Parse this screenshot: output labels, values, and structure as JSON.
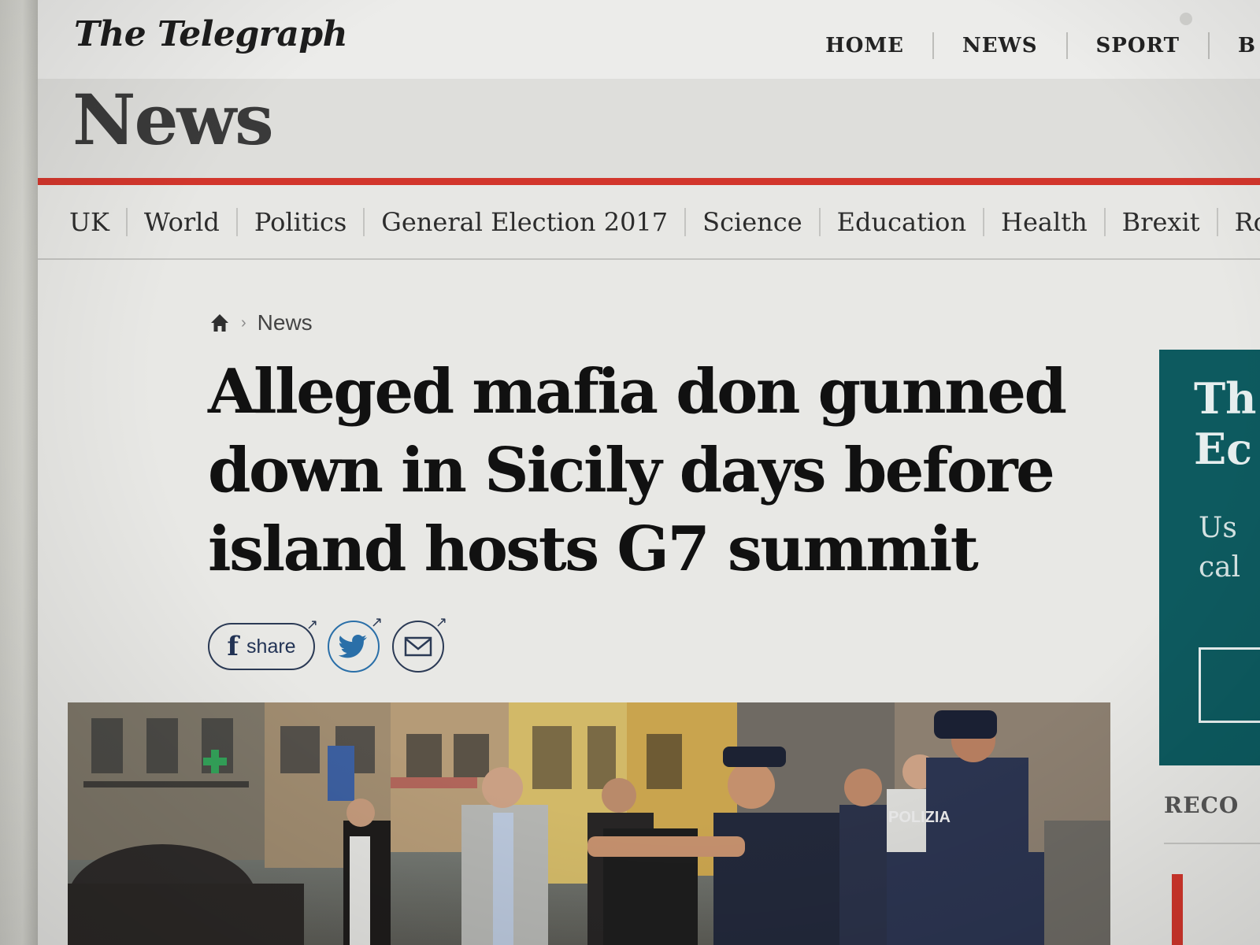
{
  "masthead": {
    "logo": "The Telegraph",
    "nav": [
      "HOME",
      "NEWS",
      "SPORT",
      "B"
    ]
  },
  "section": {
    "title": "News"
  },
  "subnav": {
    "items": [
      "UK",
      "World",
      "Politics",
      "General Election 2017",
      "Science",
      "Education",
      "Health",
      "Brexit",
      "Roy"
    ]
  },
  "breadcrumb": {
    "current": "News",
    "separator": "›"
  },
  "article": {
    "headline": "Alleged mafia don gunned down in Sicily days before island hosts G7 summit"
  },
  "share": {
    "facebook_glyph": "f",
    "facebook_label": "share",
    "external_arrow": "↗"
  },
  "photo": {
    "sign_text": "POLIZIA"
  },
  "promo": {
    "title_line1": "Th",
    "title_line2": "Ec",
    "text_line1": "Us",
    "text_line2": "cal"
  },
  "sidebar": {
    "recommended_label": "RECO"
  },
  "colors": {
    "accent_red": "#d2362c",
    "promo_teal": "#0d5a5f",
    "share_navy": "#2b3a55",
    "twitter_blue": "#2a6fa8"
  }
}
